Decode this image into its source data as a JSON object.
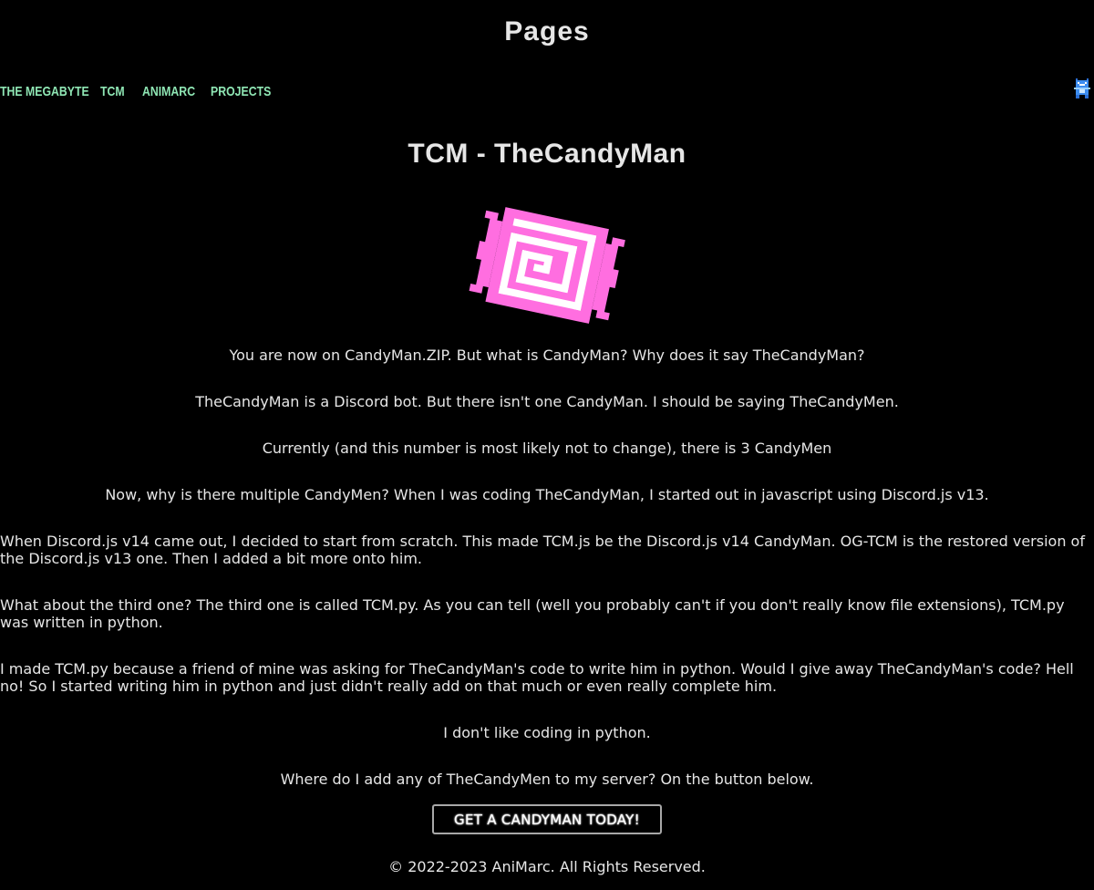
{
  "header": {
    "title": "Pages"
  },
  "nav": {
    "items": [
      {
        "label": "The MegaByte"
      },
      {
        "label": "TCM"
      },
      {
        "label": "AniMarc"
      },
      {
        "label": "Projects"
      }
    ],
    "avatar_icon": "pixel-character-icon"
  },
  "main": {
    "heading": "TCM - TheCandyMan",
    "logo_icon": "candy-spiral-icon",
    "logo_color": "#ff6ee0",
    "paragraphs": [
      "You are now on CandyMan.ZIP. But what is CandyMan? Why does it say TheCandyMan?",
      "TheCandyMan is a Discord bot. But there isn't one CandyMan. I should be saying TheCandyMen.",
      "Currently (and this number is most likely not to change), there is 3 CandyMen",
      "Now, why is there multiple CandyMen? When I was coding TheCandyMan, I started out in javascript using Discord.js v13.",
      "When Discord.js v14 came out, I decided to start from scratch. This made TCM.js be the Discord.js v14 CandyMan. OG-TCM is the restored version of the Discord.js v13 one. Then I added a bit more onto him.",
      "What about the third one? The third one is called TCM.py. As you can tell (well you probably can't if you don't really know file extensions), TCM.py was written in python.",
      "I made TCM.py because a friend of mine was asking for TheCandyMan's code to write him in python. Would I give away TheCandyMan's code? Hell no! So I started writing him in python and just didn't really add on that much or even really complete him.",
      "I don't like coding in python.",
      "Where do I add any of TheCandyMen to my server? On the button below."
    ],
    "cta_label": "GET A CANDYMAN TODAY!"
  },
  "footer": {
    "text": "© 2022-2023 AniMarc. All Rights Reserved."
  },
  "colors": {
    "background": "#000000",
    "text": "#e6e6e6",
    "nav_link": "#8fe6b4",
    "button_border": "#a8a8a8"
  }
}
